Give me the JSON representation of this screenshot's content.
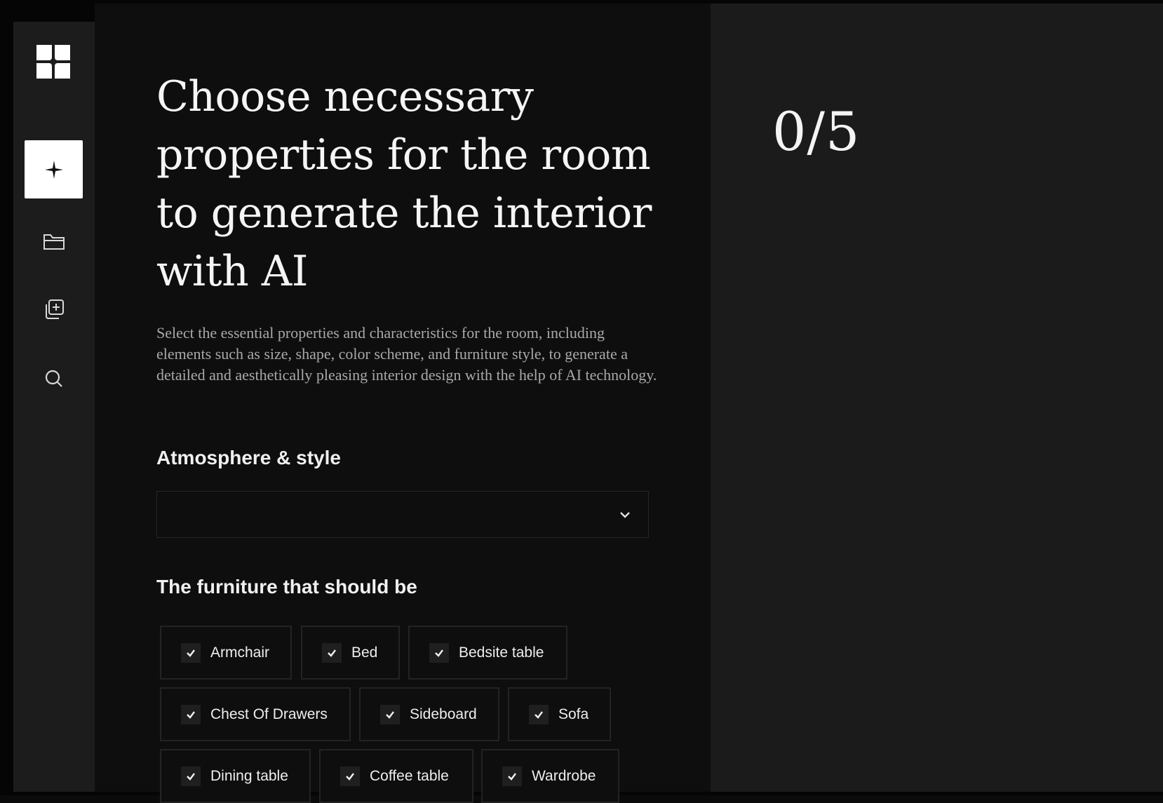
{
  "sidebar": {
    "logo": "app-logo",
    "items": [
      {
        "icon": "sparkle-icon",
        "active": true
      },
      {
        "icon": "folder-icon",
        "active": false
      },
      {
        "icon": "gallery-add-icon",
        "active": false
      },
      {
        "icon": "search-icon",
        "active": false
      }
    ]
  },
  "main": {
    "title": "Choose necessary properties for the room to generate the interior with AI",
    "description": "Select the essential properties and characteristics for the room, including elements such as size, shape, color scheme, and furniture style, to generate a detailed and aesthetically pleasing interior design with the help of AI technology.",
    "atmosphere": {
      "label": "Atmosphere & style",
      "selected_value": ""
    },
    "furniture": {
      "label": "The furniture that should be",
      "items": [
        {
          "label": "Armchair",
          "checked": true
        },
        {
          "label": "Bed",
          "checked": true
        },
        {
          "label": "Bedsite table",
          "checked": true
        },
        {
          "label": "Chest Of Drawers",
          "checked": true
        },
        {
          "label": "Sideboard",
          "checked": true
        },
        {
          "label": "Sofa",
          "checked": true
        },
        {
          "label": "Dining table",
          "checked": true
        },
        {
          "label": "Coffee table",
          "checked": true
        },
        {
          "label": "Wardrobe",
          "checked": true
        }
      ]
    }
  },
  "preview": {
    "counter": "0/5"
  },
  "colors": {
    "background": "#0e0e0e",
    "sidebar": "#1c1c1c",
    "preview_panel": "#1b1b1b",
    "accent": "#ffffff"
  }
}
